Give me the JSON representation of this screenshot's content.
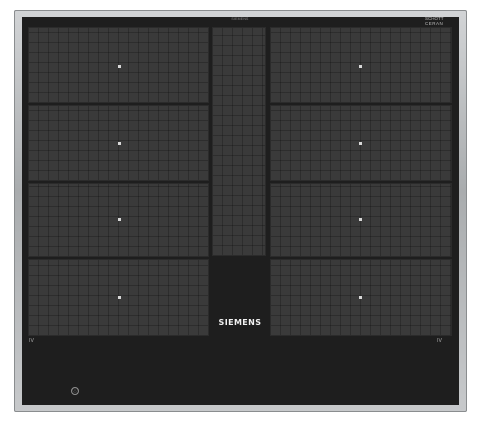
{
  "brand": "SIEMENS",
  "top_marking": "SIEMENS",
  "glass_brand": {
    "line1": "SCHOTT",
    "line2": "CERAN",
    "line3": "of Germany"
  },
  "left_label": "IV",
  "right_label": "IV",
  "power_symbol": "ⓘ",
  "icons": {
    "power": "power-icon",
    "zone_marker": "zone-marker-icon"
  },
  "colors": {
    "glass": "#1e1e1e",
    "zone": "#3a3a3a",
    "frame": "#b8bbbd"
  }
}
